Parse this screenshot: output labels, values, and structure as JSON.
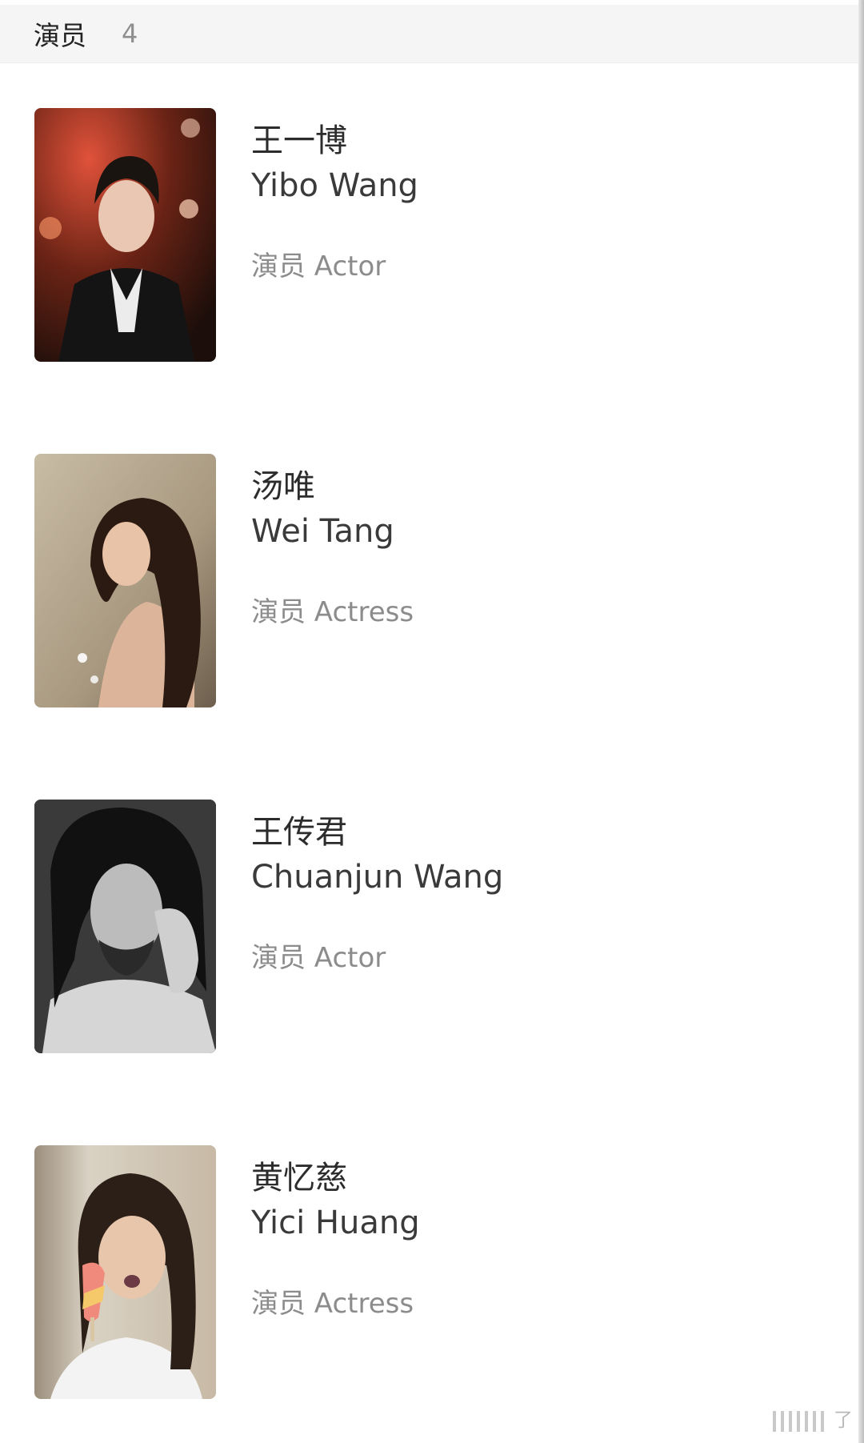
{
  "header": {
    "title": "演员",
    "count": "4"
  },
  "cast": [
    {
      "name_cn": "王一博",
      "name_en": "Yibo Wang",
      "role": "演员 Actor"
    },
    {
      "name_cn": "汤唯",
      "name_en": "Wei Tang",
      "role": "演员 Actress"
    },
    {
      "name_cn": "王传君",
      "name_en": "Chuanjun Wang",
      "role": "演员 Actor"
    },
    {
      "name_cn": "黄忆慈",
      "name_en": "Yici Huang",
      "role": "演员 Actress"
    }
  ],
  "watermark": {
    "text": "了"
  }
}
